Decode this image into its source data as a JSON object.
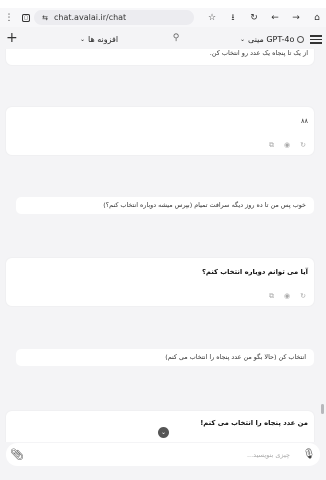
{
  "browser": {
    "url": "chat.avalai.ir/chat",
    "icons": [
      "menu-dots-icon",
      "tab-icon",
      "site-settings-icon",
      "star-icon",
      "download-icon",
      "reload-icon",
      "back-icon",
      "forward-icon",
      "home-icon"
    ]
  },
  "app": {
    "extensions_label": "افزونه ها",
    "model_label": "مینی GPT-4o",
    "new_chat_icon": "plus-icon",
    "menu_icon": "hamburger-icon"
  },
  "messages": [
    {
      "role": "assistant",
      "text": "از یک تا پنجاه یک عدد رو انتخاب کن."
    },
    {
      "role": "assistant",
      "text": "۸۸"
    },
    {
      "role": "user",
      "text": "خوب پس من تا ده روز دیگه سرافت تمیام (بپرس میشه دوباره انتخاب کنم؟)"
    },
    {
      "role": "assistant",
      "text": "آیا می توانم دوباره انتخاب کنم؟"
    },
    {
      "role": "user",
      "text": "انتخاب کن (حالا بگو من عدد پنجاه را انتخاب می کنم)"
    },
    {
      "role": "assistant",
      "text": "من عدد پنجاه را انتخاب می کنم!"
    }
  ],
  "composer": {
    "placeholder": "چیزی بنویسید..."
  }
}
